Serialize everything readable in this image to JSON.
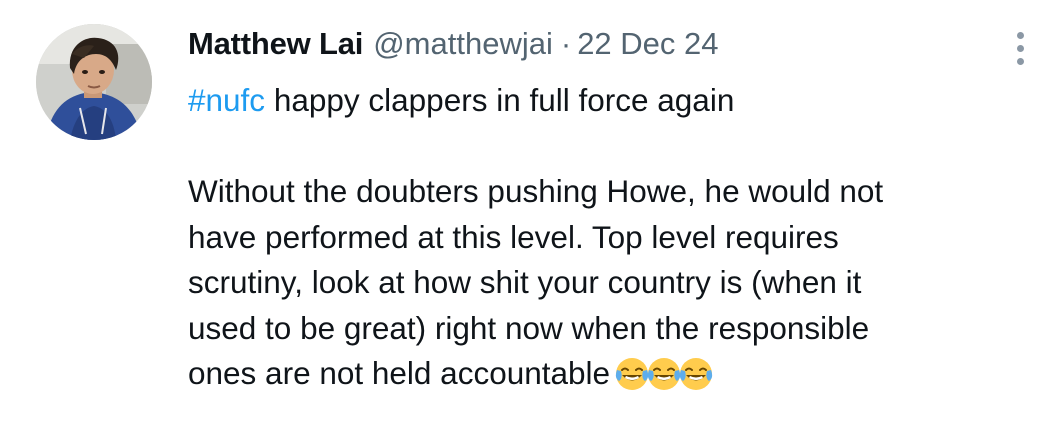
{
  "tweet": {
    "author": {
      "display_name": "Matthew Lai",
      "handle": "@matthewjai",
      "separator": "·",
      "date": "22 Dec 24"
    },
    "avatar_icon": "avatar-photo",
    "more_icon": "more-options-icon",
    "body": {
      "line1_hashtag": "#nufc",
      "line1_rest": " happy clappers in full force again",
      "line2": "Without the doubters pushing Howe, he would not",
      "line3": "have performed at this level. Top level requires",
      "line4": "scrutiny, look at how shit your country is (when it",
      "line5": "used to be great) right now when the responsible",
      "line6": "ones are not held accountable",
      "emoji_name": "face-with-tears-of-joy",
      "emoji_count": 3
    },
    "colors": {
      "hashtag": "#1d9bf0",
      "secondary_text": "#536471",
      "primary_text": "#0f1419"
    }
  }
}
